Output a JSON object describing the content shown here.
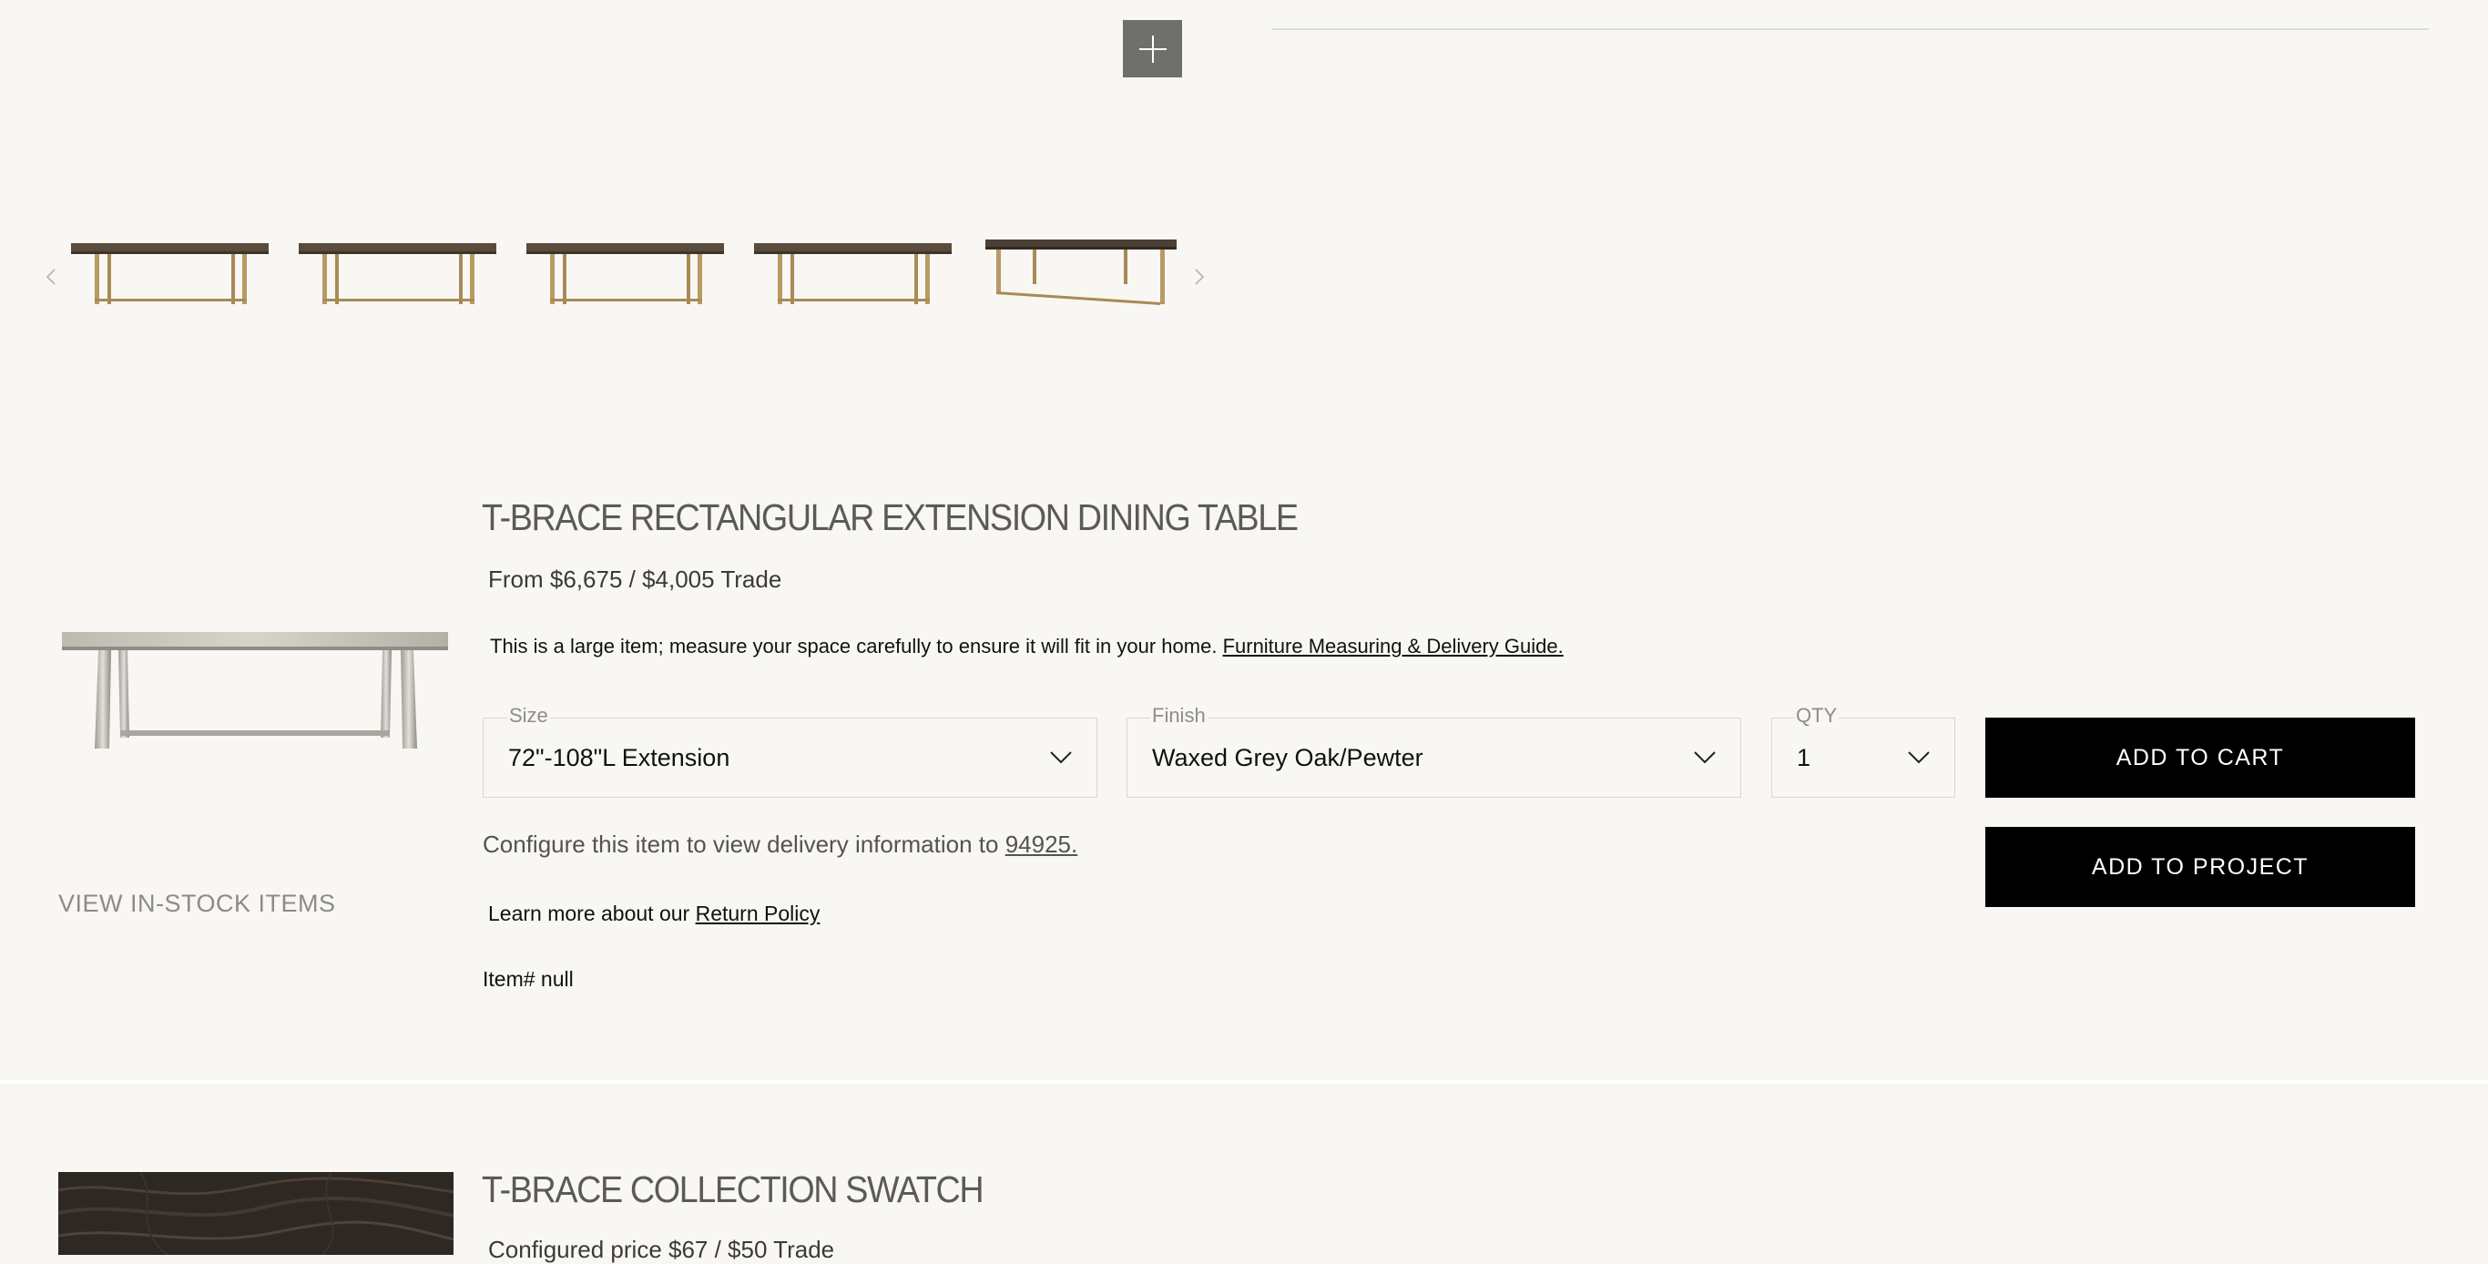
{
  "gallery": {
    "zoom_icon": "plus-icon",
    "prev_icon": "chevron-left-icon",
    "next_icon": "chevron-right-icon",
    "thumbnail_count": 5
  },
  "product": {
    "title": "T-BRACE RECTANGULAR EXTENSION DINING TABLE",
    "price": "From $6,675 / $4,005 Trade",
    "large_item_note": "This is a large item; measure your space carefully to ensure it will fit in your home.",
    "guide_link": "Furniture Measuring & Delivery Guide.",
    "view_instock": "VIEW IN-STOCK ITEMS",
    "size": {
      "label": "Size",
      "value": "72\"-108\"L Extension"
    },
    "finish": {
      "label": "Finish",
      "value": "Waxed Grey Oak/Pewter"
    },
    "qty": {
      "label": "QTY",
      "value": "1"
    },
    "add_to_cart": "ADD TO CART",
    "add_to_project": "ADD TO PROJECT",
    "delivery_text": "Configure this item to view delivery information to",
    "delivery_zip": "94925.",
    "return_text": "Learn more about our",
    "return_link": "Return Policy",
    "item_number": "Item# null"
  },
  "swatch": {
    "title": "T-BRACE COLLECTION SWATCH",
    "price": "Configured price $67 / $50 Trade"
  },
  "colors": {
    "background": "#f8f7f3",
    "button": "#000000",
    "zoom_button": "#6f6f6b",
    "muted_text": "#8d8b86"
  }
}
